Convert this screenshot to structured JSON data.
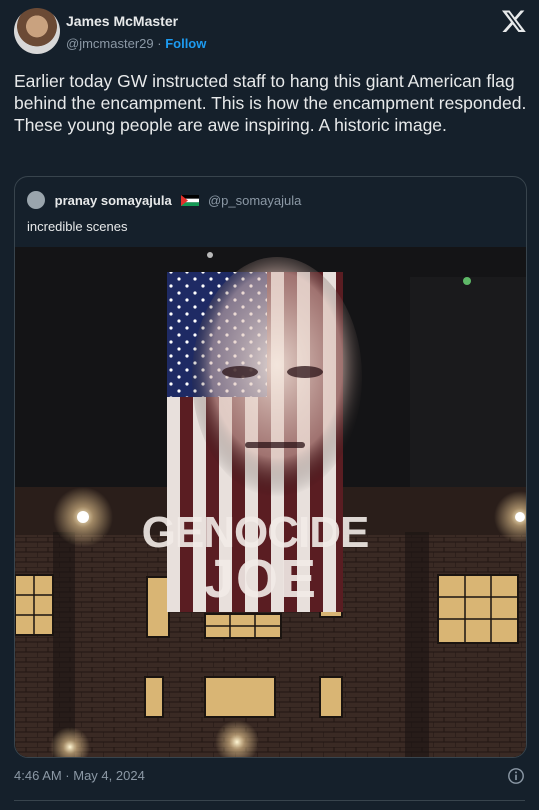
{
  "author": {
    "name": "James McMaster",
    "handle": "@jmcmaster29",
    "separator": "·",
    "follow_label": "Follow"
  },
  "tweet": {
    "text": "Earlier today GW instructed staff to hang this giant American flag behind the encampment. This is how the encampment responded. These young people are awe inspiring. A historic image."
  },
  "quote": {
    "name": "pranay somayajula",
    "handle": "@p_somayajula",
    "text": "incredible scenes",
    "image_projection_text_1": "GENOCIDE",
    "image_projection_text_2": "JOE"
  },
  "footer": {
    "timestamp": "4:46 AM · May 4, 2024"
  },
  "icons": {
    "logo": "x-logo-icon",
    "info": "info-icon",
    "flag": "palestine-flag-icon"
  },
  "colors": {
    "background": "#15202b",
    "accent": "#1d9bf0",
    "muted": "#8b98a5",
    "text": "#e7e9ea"
  }
}
